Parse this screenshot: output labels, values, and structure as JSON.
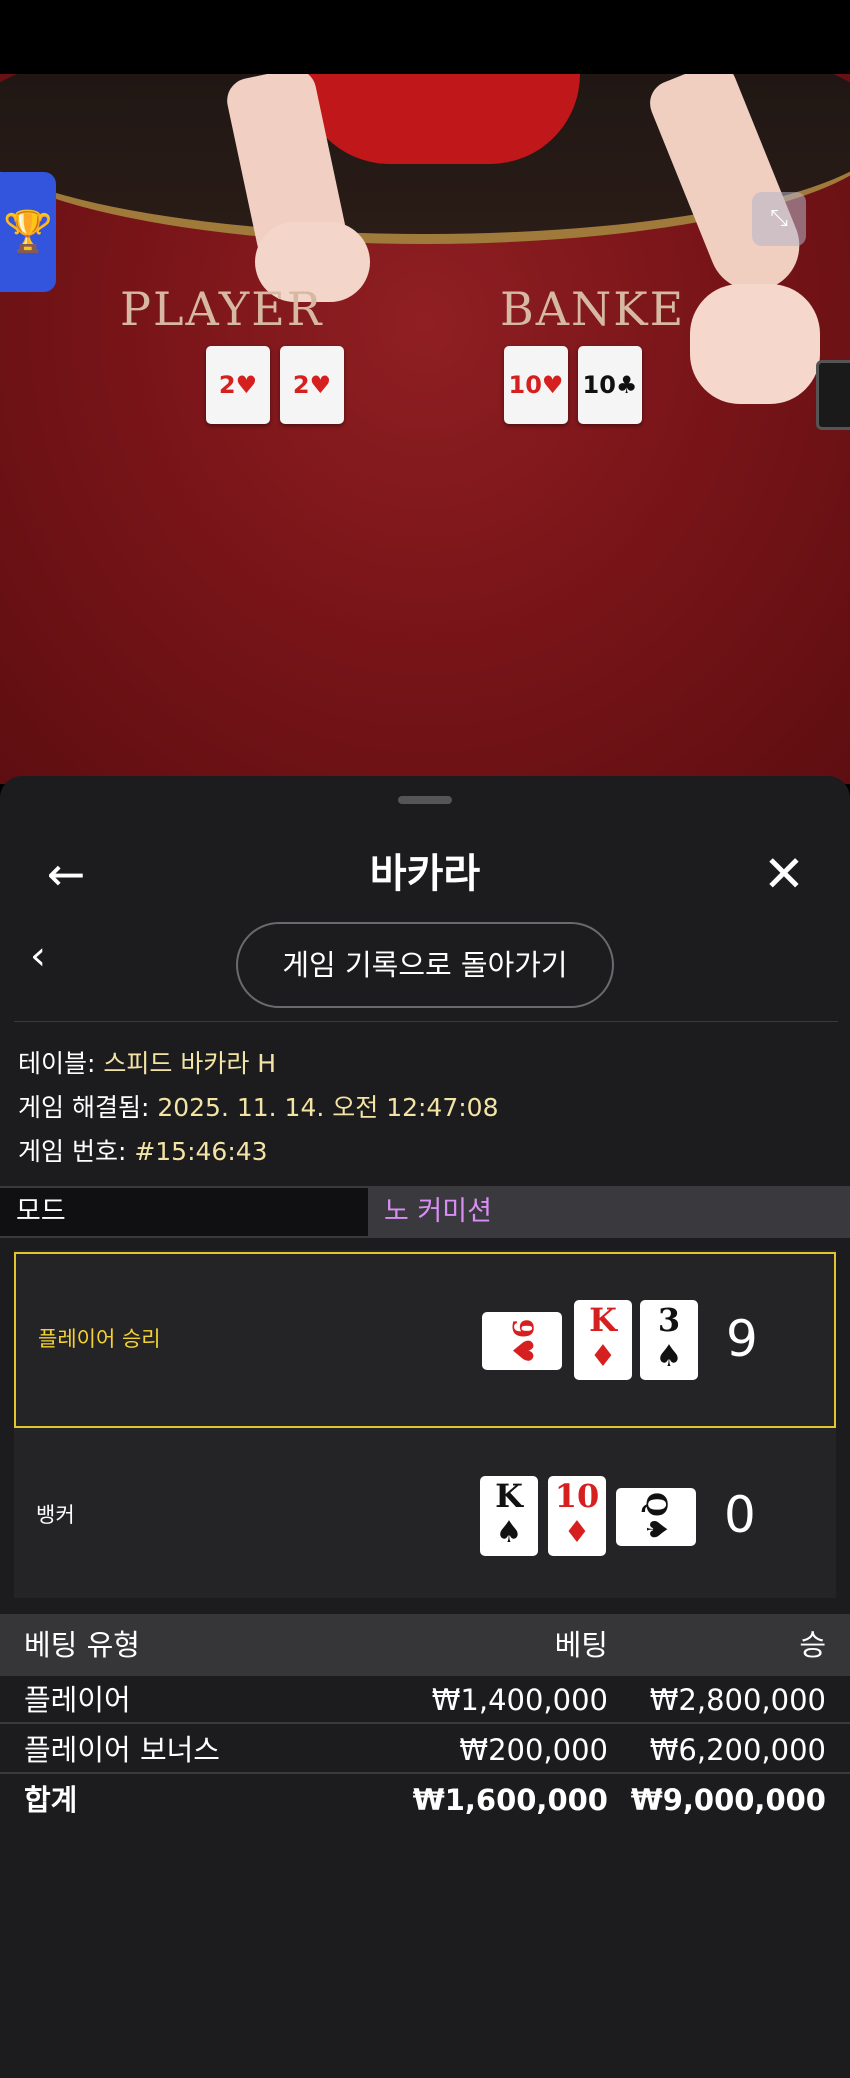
{
  "video": {
    "felt_player": "PLAYER",
    "felt_banker": "BANKE",
    "table_cards": {
      "player": [
        {
          "rank": "2",
          "suit": "♥",
          "color": "red"
        },
        {
          "rank": "2",
          "suit": "♥",
          "color": "red"
        }
      ],
      "banker": [
        {
          "rank": "10",
          "suit": "♥",
          "color": "red"
        },
        {
          "rank": "10",
          "suit": "♣",
          "color": "black"
        }
      ]
    },
    "expand_icon": "compress-icon",
    "trophy_icon": "trophy-icon"
  },
  "header": {
    "title": "바카라",
    "back_icon": "←",
    "close_icon": "✕"
  },
  "sub": {
    "back_icon": "‹",
    "history_button": "게임 기록으로 돌아가기"
  },
  "info": {
    "table_label": "테이블: ",
    "table_value": "스피드 바카라 H",
    "resolved_label": "게임 해결됨: ",
    "resolved_value": "2025. 11. 14. 오전 12:47:08",
    "game_no_label": "게임 번호: ",
    "game_no_value": "#15:46:43"
  },
  "mode": {
    "label": "모드",
    "value": "노 커미션"
  },
  "results": {
    "player": {
      "label": "플레이어 승리",
      "score": "9",
      "cards": [
        {
          "rank": "9",
          "suit": "♥",
          "color": "red",
          "sideways": true
        },
        {
          "rank": "K",
          "suit": "♦",
          "color": "red",
          "sideways": false
        },
        {
          "rank": "3",
          "suit": "♠",
          "color": "black",
          "sideways": false
        }
      ]
    },
    "banker": {
      "label": "뱅커",
      "score": "0",
      "cards": [
        {
          "rank": "K",
          "suit": "♠",
          "color": "black",
          "sideways": false
        },
        {
          "rank": "10",
          "suit": "♦",
          "color": "red",
          "sideways": false
        },
        {
          "rank": "Q",
          "suit": "♠",
          "color": "black",
          "sideways": true
        }
      ]
    }
  },
  "bets": {
    "headers": {
      "type": "베팅 유형",
      "bet": "베팅",
      "win": "승"
    },
    "rows": [
      {
        "type": "플레이어",
        "bet": "₩1,400,000",
        "win": "₩2,800,000"
      },
      {
        "type": "플레이어 보너스",
        "bet": "₩200,000",
        "win": "₩6,200,000"
      }
    ],
    "total": {
      "type": "합계",
      "bet": "₩1,600,000",
      "win": "₩9,000,000"
    }
  },
  "colors": {
    "accent_yellow": "#f3d233",
    "info_value": "#f3e3a4",
    "mode_value": "#d88ef5",
    "felt_red": "#7a1519"
  }
}
